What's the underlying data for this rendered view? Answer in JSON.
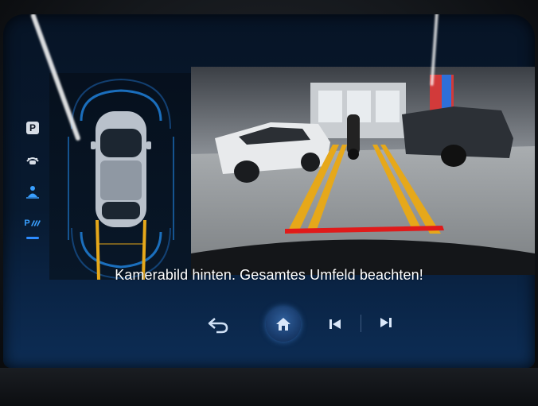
{
  "screen": {
    "caption": "Kamerabild hinten. Gesamtes Umfeld beachten!"
  },
  "sidebar": {
    "items": [
      {
        "id": "parking",
        "label": "P",
        "icon": "parking-icon"
      },
      {
        "id": "camera-view",
        "label": "",
        "icon": "camera-view-icon"
      },
      {
        "id": "sensors",
        "label": "",
        "icon": "sensor-person-icon"
      },
      {
        "id": "park-assist",
        "label": "P",
        "icon": "park-assist-icon",
        "active": true
      }
    ]
  },
  "controls": {
    "back": "back-arrow-icon",
    "home": "home-icon",
    "previous": "skip-previous-icon",
    "next": "skip-next-icon"
  },
  "colors": {
    "accent": "#2d8cff",
    "guide_yellow": "#e6a81a",
    "stop_line_red": "#e01a1a",
    "screen_bg": "#081a30"
  }
}
